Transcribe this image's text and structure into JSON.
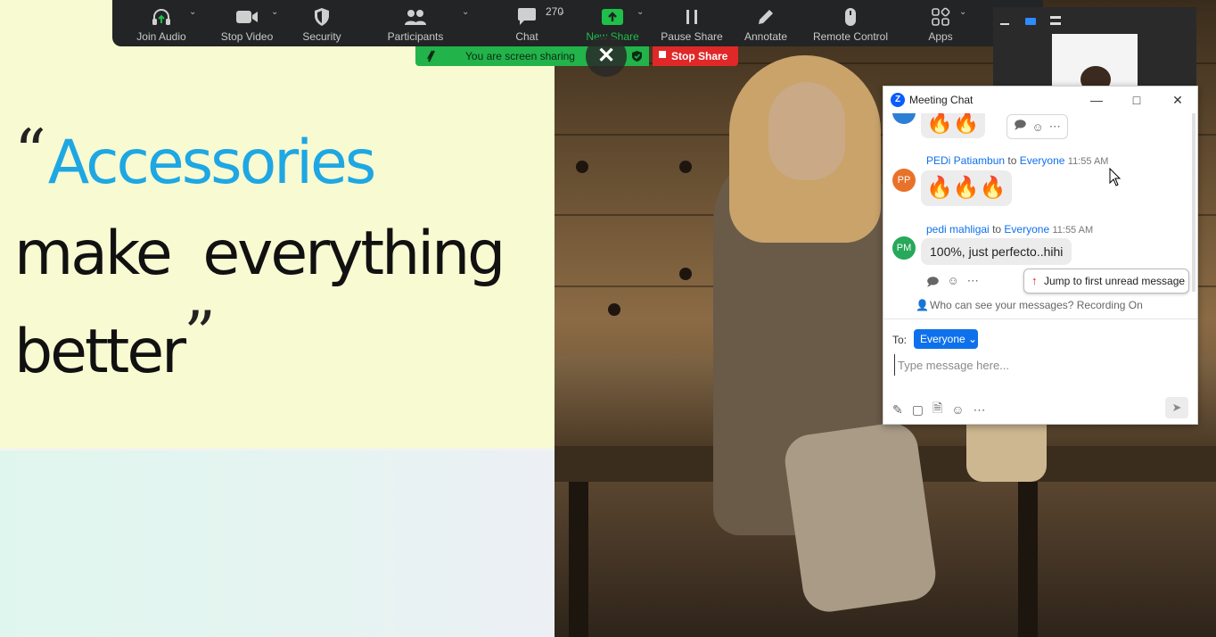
{
  "slide": {
    "line1": "Accessories",
    "line2": "make everything",
    "line3": "better",
    "open_quote": "“",
    "close_quote": "”",
    "accent_color": "#1ea7e3"
  },
  "toolbar": {
    "items": [
      {
        "label": "Join Audio",
        "icon": "headphones-icon"
      },
      {
        "label": "Stop Video",
        "icon": "video-camera-icon"
      },
      {
        "label": "Security",
        "icon": "shield-icon"
      },
      {
        "label": "Participants",
        "icon": "people-icon"
      },
      {
        "label": "Chat",
        "icon": "chat-bubble-icon"
      },
      {
        "label": "New Share",
        "icon": "share-arrow-icon"
      },
      {
        "label": "Pause Share",
        "icon": "pause-icon"
      },
      {
        "label": "Annotate",
        "icon": "pencil-icon"
      },
      {
        "label": "Remote Control",
        "icon": "mouse-icon"
      },
      {
        "label": "Apps",
        "icon": "apps-icon"
      }
    ],
    "participants_count": "270",
    "share_color": "#1fbf4a"
  },
  "share_banner": {
    "text": "You are screen sharing",
    "stop_label": "Stop Share"
  },
  "chat": {
    "title": "Meeting Chat",
    "messages": [
      {
        "sender": "PEDi Patiambun",
        "to": "to",
        "recipient": "Everyone",
        "time": "11:55 AM",
        "initials": "PP",
        "content": "🔥🔥🔥"
      },
      {
        "sender": "pedi mahligai",
        "to": "to",
        "recipient": "Everyone",
        "time": "11:55 AM",
        "initials": "PM",
        "content": "100%, just perfecto..hihi"
      }
    ],
    "prev_message_content": "🔥🔥",
    "jump_label": "Jump to first unread message",
    "visibility_notice": "Who can see your messages? Recording On",
    "to_label": "To:",
    "recipient_button": "Everyone",
    "input_placeholder": "Type message here..."
  }
}
